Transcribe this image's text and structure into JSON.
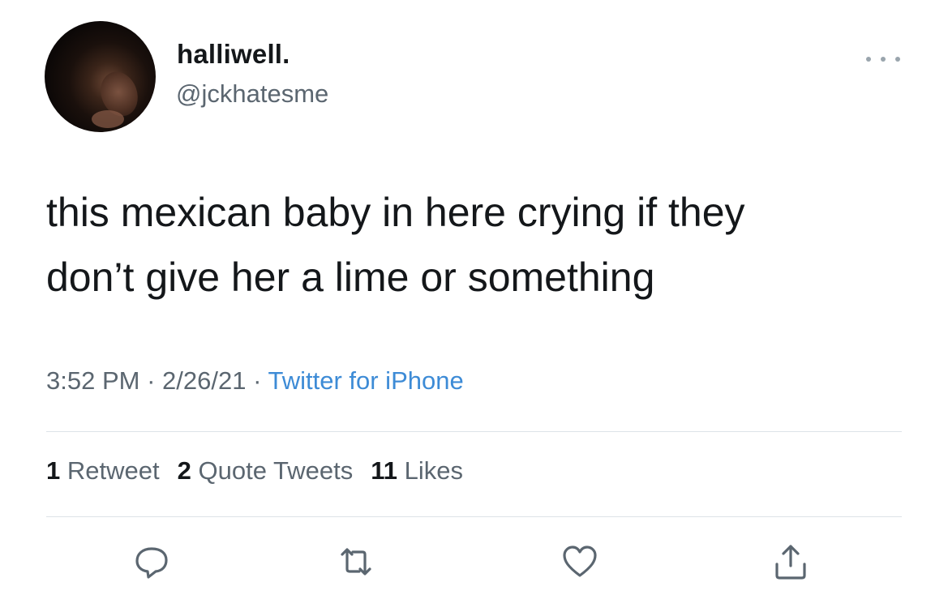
{
  "tweet": {
    "display_name": "halliwell.",
    "handle": "@jckhatesme",
    "text_line1": "this mexican baby in here crying if they",
    "text_line2": "don’t give her a lime or something",
    "time": "3:52 PM",
    "separator": "·",
    "date": "2/26/21",
    "source": "Twitter for iPhone"
  },
  "stats": {
    "retweets_count": "1",
    "retweets_label": "Retweet",
    "quotes_count": "2",
    "quotes_label": "Quote Tweets",
    "likes_count": "11",
    "likes_label": "Likes"
  },
  "actions": {
    "icons": [
      "reply-icon",
      "retweet-icon",
      "like-icon",
      "share-icon"
    ]
  },
  "colors": {
    "text": "#14171a",
    "secondary": "#5b6670",
    "link": "#3d8bd6",
    "divider": "#dde3e8"
  }
}
